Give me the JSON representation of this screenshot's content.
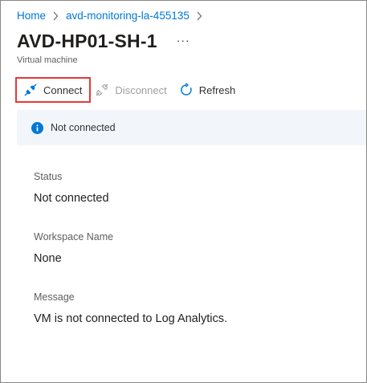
{
  "breadcrumb": {
    "items": [
      "Home",
      "avd-monitoring-la-455135"
    ]
  },
  "header": {
    "title": "AVD-HP01-SH-1",
    "more": "···",
    "subtitle": "Virtual machine"
  },
  "toolbar": {
    "connect_label": "Connect",
    "disconnect_label": "Disconnect",
    "refresh_label": "Refresh"
  },
  "info_bar": {
    "message": "Not connected",
    "icon": "info-icon"
  },
  "fields": [
    {
      "label": "Status",
      "value": "Not connected"
    },
    {
      "label": "Workspace Name",
      "value": "None"
    },
    {
      "label": "Message",
      "value": "VM is not connected to Log Analytics."
    }
  ],
  "colors": {
    "link": "#0078d4",
    "highlight_border": "#e5393a",
    "info_bg": "#f2f6fb",
    "disabled_text": "#a19f9d"
  }
}
